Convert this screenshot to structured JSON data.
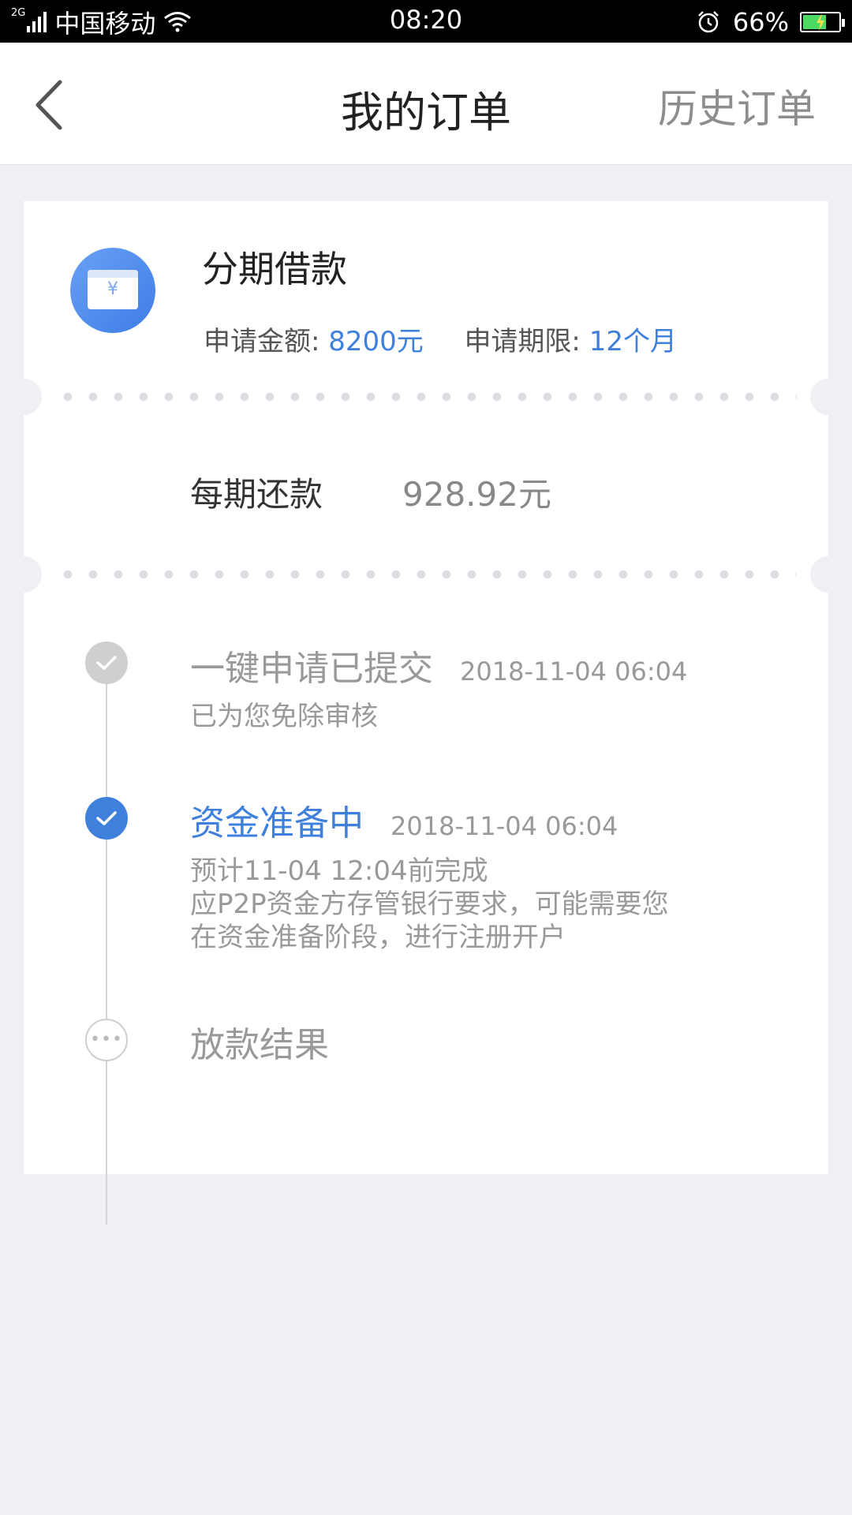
{
  "status_bar": {
    "network": "2G",
    "carrier": "中国移动",
    "time": "08:20",
    "battery_pct": "66%",
    "battery_level": 0.66,
    "battery_color": "#4cd964"
  },
  "nav": {
    "title": "我的订单",
    "history": "历史订单"
  },
  "order": {
    "product": "分期借款",
    "amount_label": "申请金额:",
    "amount_value": "8200元",
    "term_label": "申请期限:",
    "term_value": "12个月",
    "repay_label": "每期还款",
    "repay_value": "928.92元"
  },
  "timeline": {
    "steps": [
      {
        "title": "一键申请已提交",
        "time": "2018-11-04 06:04",
        "desc": [
          "已为您免除审核"
        ],
        "state": "done"
      },
      {
        "title": "资金准备中",
        "time": "2018-11-04 06:04",
        "desc": [
          "预计11-04 12:04前完成",
          "应P2P资金方存管银行要求，可能需要您",
          "在资金准备阶段，进行注册开户"
        ],
        "state": "active"
      },
      {
        "title": "放款结果",
        "state": "pending"
      }
    ]
  },
  "colors": {
    "accent": "#3f80dc",
    "background": "#eef0f4"
  },
  "icons": {
    "back": "chevron-left-icon",
    "product": "wallet-yen-icon",
    "done": "check-icon",
    "pending": "ellipsis-icon"
  }
}
